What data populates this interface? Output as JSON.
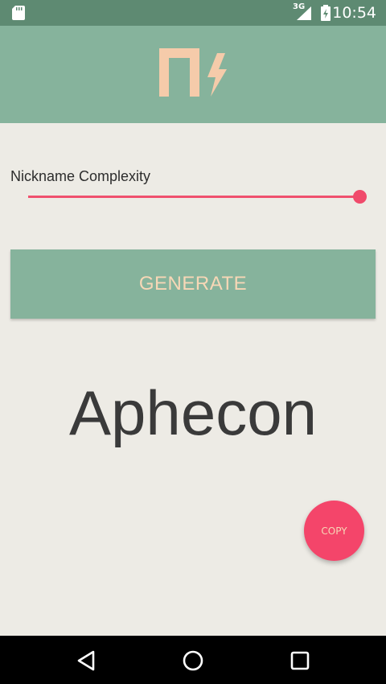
{
  "status_bar": {
    "network_label": "3G",
    "time": "10:54"
  },
  "app_bar": {
    "logo_icon": "nick-bolt-logo-icon",
    "logo_colors": {
      "primary": "#f5cbaa",
      "background": "#86b39c"
    }
  },
  "main": {
    "slider": {
      "label": "Nickname Complexity",
      "value_fraction": 1.0,
      "accent_color": "#f0506e"
    },
    "generate_button": {
      "label": "GENERATE",
      "background": "#86b39c",
      "text_color": "#f7d7b6"
    },
    "nickname": "Aphecon",
    "copy_fab": {
      "label": "COPY",
      "background": "#f4456a"
    }
  },
  "nav_bar": {
    "back_icon": "back-triangle-icon",
    "home_icon": "home-circle-icon",
    "recents_icon": "recents-square-icon"
  }
}
